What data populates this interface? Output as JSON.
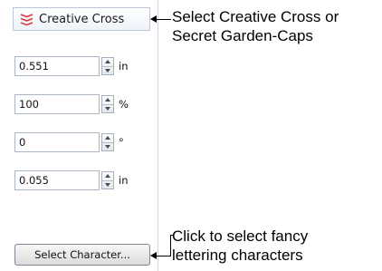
{
  "font_dropdown": {
    "value": "Creative Cross",
    "icon": "font-style-icon",
    "icon_color": "#e0383e"
  },
  "fields": [
    {
      "value": "0.551",
      "unit": "in"
    },
    {
      "value": "100",
      "unit": "%"
    },
    {
      "value": "0",
      "unit": "°"
    },
    {
      "value": "0.055",
      "unit": "in"
    }
  ],
  "select_character_button": {
    "label": "Select Character..."
  },
  "callouts": {
    "font": {
      "line1": "Select Creative Cross or",
      "line2": "Secret Garden-Caps"
    },
    "character": {
      "line1": "Click to select fancy",
      "line2": "lettering characters"
    }
  }
}
